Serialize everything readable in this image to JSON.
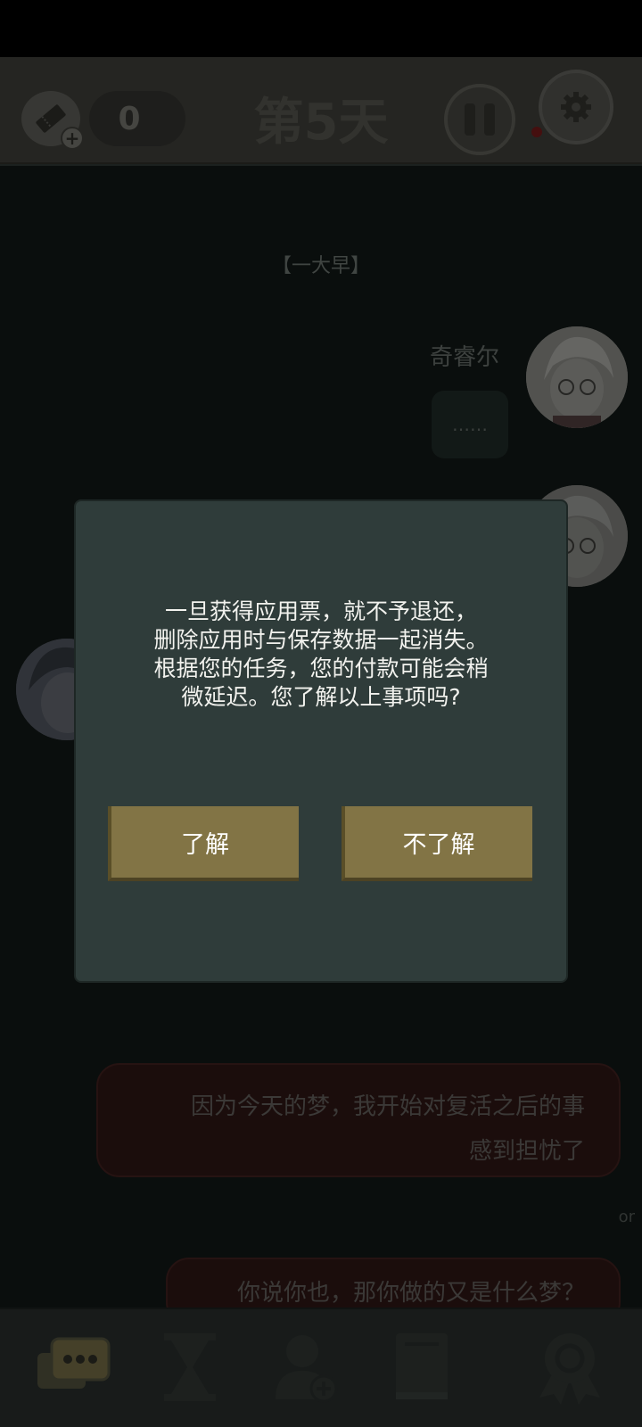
{
  "header": {
    "ticket_count": "0",
    "day_title": "第5天",
    "ticket_icon": "ticket-icon",
    "pause_icon": "pause-icon",
    "settings_icon": "gear-icon"
  },
  "chat": {
    "time_label": "【一大早】",
    "messages": [
      {
        "sender": "奇睿尔",
        "text": "……"
      }
    ],
    "choices": [
      {
        "text_line1": "因为今天的梦，我开始对复活之后的事",
        "text_line2": "感到担忧了"
      },
      {
        "text": "你说你也，那你做的又是什么梦？"
      }
    ],
    "or_label": "or"
  },
  "dialog": {
    "message": "一旦获得应用票，就不予退还，\n删除应用时与保存数据一起消失。\n根据您的任务，您的付款可能会稍\n微延迟。您了解以上事项吗?",
    "ok_label": "了解",
    "cancel_label": "不了解"
  },
  "bottom_nav": {
    "items": [
      {
        "icon": "chat-icon",
        "active": true
      },
      {
        "icon": "hourglass-icon",
        "active": false
      },
      {
        "icon": "add-friend-icon",
        "active": false
      },
      {
        "icon": "book-icon",
        "active": false
      },
      {
        "icon": "achievement-badge-icon",
        "active": false
      }
    ]
  },
  "colors": {
    "dialog_bg": "#2f3c3a",
    "button_bg": "#827445",
    "choice_bg": "#2a1413"
  }
}
